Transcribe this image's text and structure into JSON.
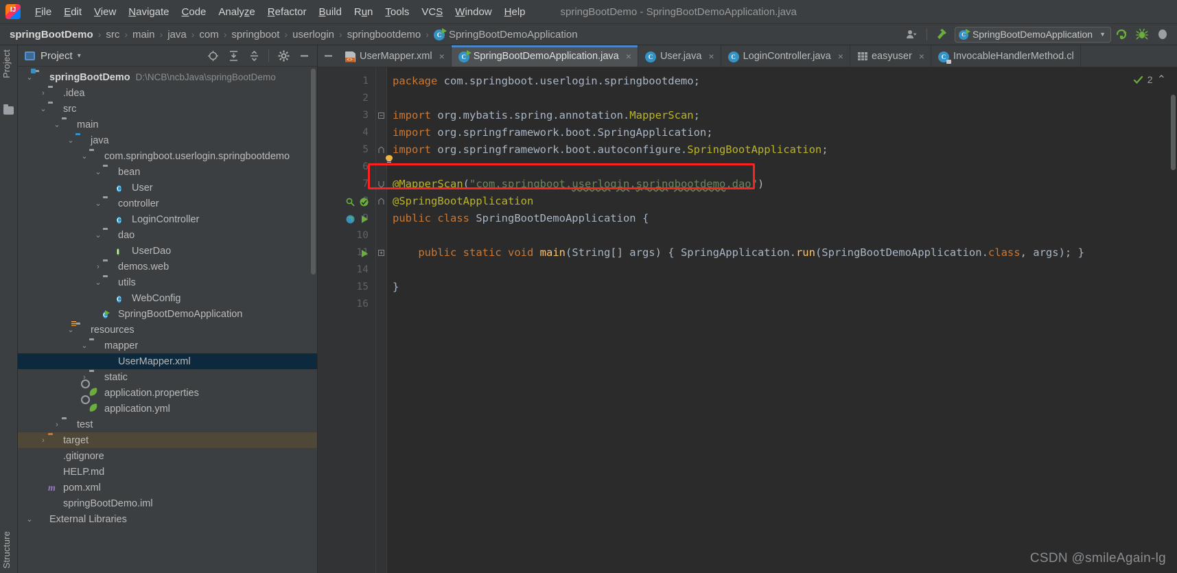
{
  "window": {
    "title": "springBootDemo - SpringBootDemoApplication.java"
  },
  "menubar": {
    "items": [
      {
        "label": "File",
        "mnemonic": "F"
      },
      {
        "label": "Edit",
        "mnemonic": "E"
      },
      {
        "label": "View",
        "mnemonic": "V"
      },
      {
        "label": "Navigate",
        "mnemonic": "N"
      },
      {
        "label": "Code",
        "mnemonic": "C"
      },
      {
        "label": "Analyze",
        "mnemonic": "z"
      },
      {
        "label": "Refactor",
        "mnemonic": "R"
      },
      {
        "label": "Build",
        "mnemonic": "B"
      },
      {
        "label": "Run",
        "mnemonic": "u"
      },
      {
        "label": "Tools",
        "mnemonic": "T"
      },
      {
        "label": "VCS",
        "mnemonic": "S"
      },
      {
        "label": "Window",
        "mnemonic": "W"
      },
      {
        "label": "Help",
        "mnemonic": "H"
      }
    ]
  },
  "navbar": {
    "crumbs": [
      "springBootDemo",
      "src",
      "main",
      "java",
      "com",
      "springboot",
      "userlogin",
      "springbootdemo",
      "SpringBootDemoApplication"
    ],
    "separator": "›",
    "run_config": "SpringBootDemoApplication",
    "dropdown_arrow": "▼",
    "icons": [
      "user-avatar-icon",
      "build-hammer-icon",
      "run-icon",
      "debug-icon",
      "stop-icon"
    ]
  },
  "toolstrip": {
    "project_tab": "Project",
    "structure_tab": "Structure"
  },
  "project_panel": {
    "title": "Project",
    "dropdown_arrow": "▾",
    "tools": [
      "locate-icon",
      "expand-all-icon",
      "collapse-all-icon",
      "settings-gear-icon",
      "hide-icon"
    ],
    "tree": [
      {
        "depth": 0,
        "twisty": "⌄",
        "icon": "f-mod",
        "label": "springBootDemo",
        "bold": true,
        "path": "D:\\NCB\\ncbJava\\springBootDemo"
      },
      {
        "depth": 1,
        "twisty": "›",
        "icon": "f-gray",
        "label": ".idea"
      },
      {
        "depth": 1,
        "twisty": "⌄",
        "icon": "f-gray",
        "label": "src"
      },
      {
        "depth": 2,
        "twisty": "⌄",
        "icon": "f-gray",
        "label": "main"
      },
      {
        "depth": 3,
        "twisty": "⌄",
        "icon": "f-blue",
        "label": "java"
      },
      {
        "depth": 4,
        "twisty": "⌄",
        "icon": "f-pkg",
        "label": "com.springboot.userlogin.springbootdemo"
      },
      {
        "depth": 5,
        "twisty": "⌄",
        "icon": "f-pkg",
        "label": "bean"
      },
      {
        "depth": 6,
        "twisty": "",
        "icon": "c-class",
        "label": "User"
      },
      {
        "depth": 5,
        "twisty": "⌄",
        "icon": "f-pkg",
        "label": "controller"
      },
      {
        "depth": 6,
        "twisty": "",
        "icon": "c-class",
        "label": "LoginController"
      },
      {
        "depth": 5,
        "twisty": "⌄",
        "icon": "f-pkg",
        "label": "dao"
      },
      {
        "depth": 6,
        "twisty": "",
        "icon": "c-iface",
        "label": "UserDao"
      },
      {
        "depth": 5,
        "twisty": "›",
        "icon": "f-pkg",
        "label": "demos.web"
      },
      {
        "depth": 5,
        "twisty": "⌄",
        "icon": "f-pkg",
        "label": "utils"
      },
      {
        "depth": 6,
        "twisty": "",
        "icon": "c-class",
        "label": "WebConfig"
      },
      {
        "depth": 5,
        "twisty": "",
        "icon": "c-spring",
        "label": "SpringBootDemoApplication"
      },
      {
        "depth": 3,
        "twisty": "⌄",
        "icon": "f-res",
        "label": "resources"
      },
      {
        "depth": 4,
        "twisty": "⌄",
        "icon": "f-gray",
        "label": "mapper"
      },
      {
        "depth": 5,
        "twisty": "",
        "icon": "xml",
        "label": "UserMapper.xml",
        "selected": true
      },
      {
        "depth": 4,
        "twisty": "›",
        "icon": "f-gray",
        "label": "static"
      },
      {
        "depth": 4,
        "twisty": "",
        "icon": "spring",
        "label": "application.properties"
      },
      {
        "depth": 4,
        "twisty": "",
        "icon": "spring",
        "label": "application.yml"
      },
      {
        "depth": 2,
        "twisty": "›",
        "icon": "f-gray",
        "label": "test"
      },
      {
        "depth": 1,
        "twisty": "›",
        "icon": "f-orange",
        "label": "target",
        "dim_selected": true
      },
      {
        "depth": 1,
        "twisty": "",
        "icon": "git",
        "label": ".gitignore"
      },
      {
        "depth": 1,
        "twisty": "",
        "icon": "md",
        "label": "HELP.md"
      },
      {
        "depth": 1,
        "twisty": "",
        "icon": "maven",
        "label": "pom.xml"
      },
      {
        "depth": 1,
        "twisty": "",
        "icon": "iml",
        "label": "springBootDemo.iml"
      },
      {
        "depth": 0,
        "twisty": "⌄",
        "icon": "lib",
        "label": "External Libraries"
      }
    ]
  },
  "editor": {
    "tabs": [
      {
        "label": "UserMapper.xml",
        "icon": "xml-file-icon",
        "active": false,
        "close": "×"
      },
      {
        "label": "SpringBootDemoApplication.java",
        "icon": "spring-class-icon",
        "active": true,
        "close": "×"
      },
      {
        "label": "User.java",
        "icon": "java-class-icon",
        "active": false,
        "close": "×"
      },
      {
        "label": "LoginController.java",
        "icon": "java-class-icon",
        "active": false,
        "close": "×"
      },
      {
        "label": "easyuser",
        "icon": "db-table-icon",
        "active": false,
        "close": "×"
      },
      {
        "label": "InvocableHandlerMethod.cl",
        "icon": "readonly-class-icon",
        "active": false,
        "close": ""
      }
    ],
    "inspection": {
      "count": "2",
      "check": "✓",
      "chevron": "⌃"
    },
    "line_numbers": [
      "1",
      "2",
      "3",
      "4",
      "5",
      "6",
      "7",
      "8",
      "9",
      "10",
      "11",
      "14",
      "15",
      "16"
    ],
    "code": [
      {
        "n": "1",
        "segments": [
          {
            "t": "package ",
            "c": "kw"
          },
          {
            "t": "com.springboot.userlogin.springbootdemo;",
            "c": "pln"
          }
        ]
      },
      {
        "n": "2",
        "segments": []
      },
      {
        "n": "3",
        "fold": "minus",
        "segments": [
          {
            "t": "import ",
            "c": "kw"
          },
          {
            "t": "org.mybatis.spring.annotation.",
            "c": "pln"
          },
          {
            "t": "MapperScan",
            "c": "ann"
          },
          {
            "t": ";",
            "c": "pln"
          }
        ]
      },
      {
        "n": "4",
        "segments": [
          {
            "t": "import ",
            "c": "kw"
          },
          {
            "t": "org.springframework.boot.SpringApplication;",
            "c": "pln"
          }
        ]
      },
      {
        "n": "5",
        "fold": "up",
        "segments": [
          {
            "t": "import ",
            "c": "kw"
          },
          {
            "t": "org.springframework.boot.autoconfigure.",
            "c": "pln"
          },
          {
            "t": "SpringBootApplication",
            "c": "ann"
          },
          {
            "t": ";",
            "c": "pln"
          }
        ]
      },
      {
        "n": "6",
        "segments": []
      },
      {
        "n": "7",
        "fold": "down",
        "segments": [
          {
            "t": "@MapperScan",
            "c": "ann"
          },
          {
            "t": "(",
            "c": "pln"
          },
          {
            "t": "\"com.springboot.",
            "c": "str"
          },
          {
            "t": "userlogin",
            "c": "str wavy"
          },
          {
            "t": ".",
            "c": "str"
          },
          {
            "t": "springbootdemo",
            "c": "str wavy"
          },
          {
            "t": ".dao\"",
            "c": "str"
          },
          {
            "t": ")",
            "c": "pln"
          }
        ]
      },
      {
        "n": "8",
        "fold": "up",
        "segments": [
          {
            "t": "@SpringBootApplication",
            "c": "ann"
          }
        ]
      },
      {
        "n": "9",
        "segments": [
          {
            "t": "public ",
            "c": "kw"
          },
          {
            "t": "class ",
            "c": "kw"
          },
          {
            "t": "SpringBootDemoApplication ",
            "c": "pln"
          },
          {
            "t": "{",
            "c": "pln"
          }
        ]
      },
      {
        "n": "10",
        "segments": []
      },
      {
        "n": "11",
        "fold": "box",
        "segments": [
          {
            "t": "    public ",
            "c": "kw"
          },
          {
            "t": "static ",
            "c": "kw"
          },
          {
            "t": "void ",
            "c": "kw"
          },
          {
            "t": "main",
            "c": "typ"
          },
          {
            "t": "(String[] args) ",
            "c": "pln"
          },
          {
            "t": "{ ",
            "c": "pln"
          },
          {
            "t": "SpringApplication.",
            "c": "pln"
          },
          {
            "t": "run",
            "c": "typ"
          },
          {
            "t": "(SpringBootDemoApplication.",
            "c": "pln"
          },
          {
            "t": "class",
            "c": "kw"
          },
          {
            "t": ", args); }",
            "c": "pln"
          }
        ]
      },
      {
        "n": "14",
        "segments": []
      },
      {
        "n": "15",
        "segments": [
          {
            "t": "}",
            "c": "pln"
          }
        ]
      },
      {
        "n": "16",
        "segments": []
      }
    ],
    "gutter_marks": [
      {
        "line_index": 7,
        "icons": [
          "bean-search-icon",
          "spring-bean-icon"
        ]
      },
      {
        "line_index": 8,
        "icons": [
          "spring-boot-icon",
          "run-gutter-icon"
        ]
      },
      {
        "line_index": 10,
        "icons": [
          "run-gutter-icon"
        ]
      }
    ],
    "annotation": {
      "type": "red-rectangle",
      "target_line": "7"
    },
    "hint_bulb": "intention-bulb-icon",
    "watermark": "CSDN @smileAgain-lg"
  }
}
